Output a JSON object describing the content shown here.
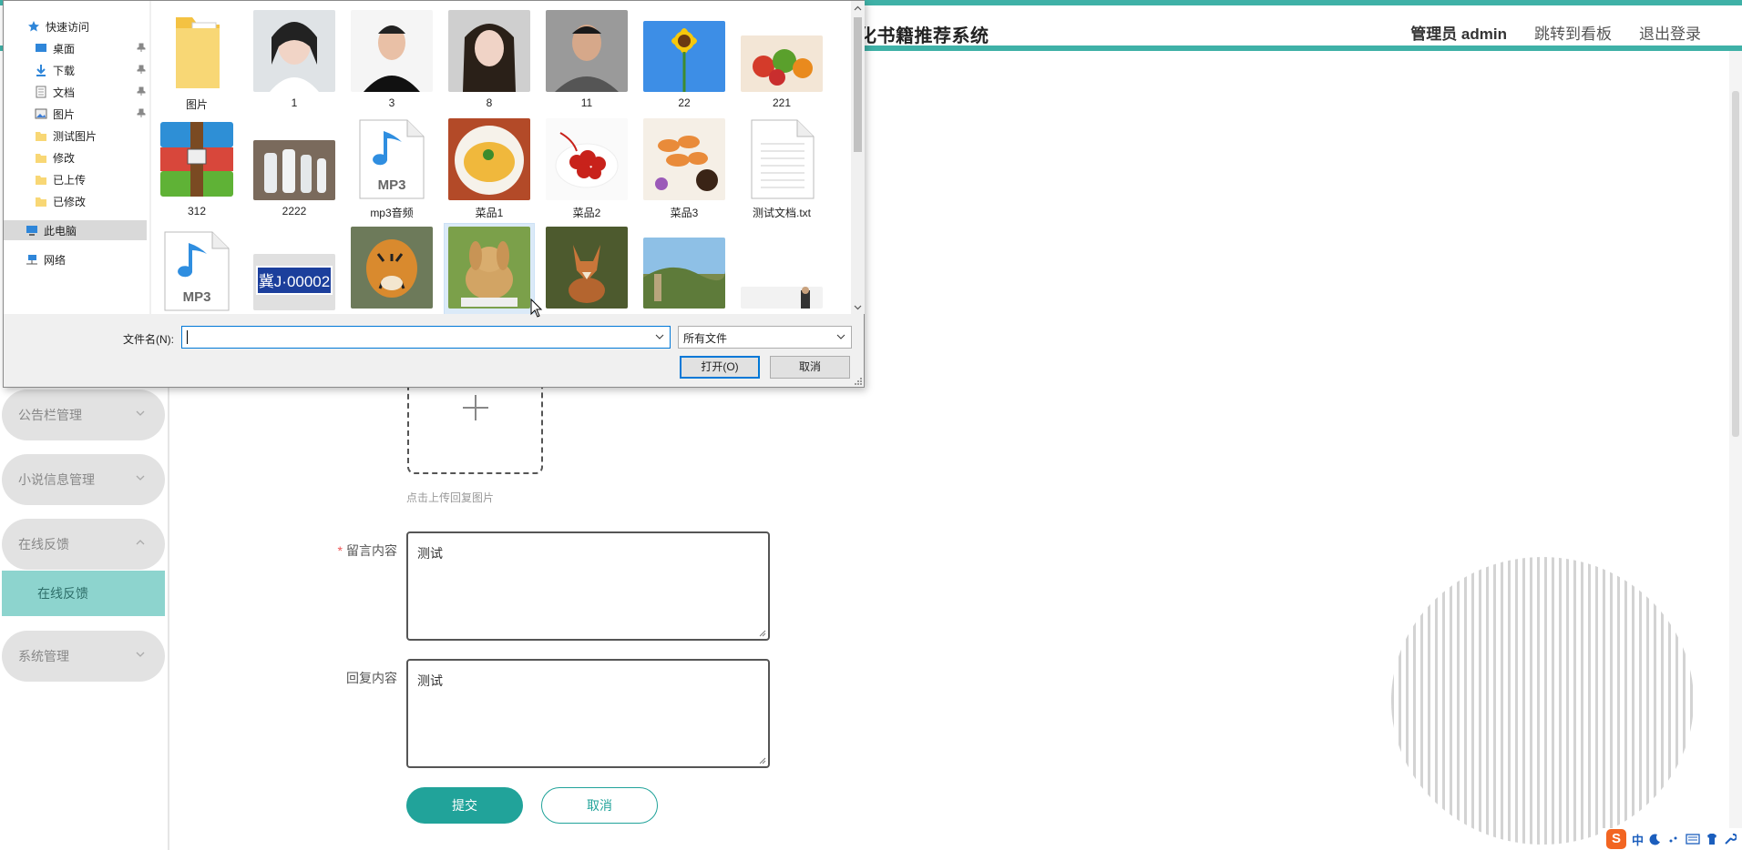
{
  "header": {
    "title": "化书籍推荐系统",
    "admin": "管理员 admin",
    "link_dashboard": "跳转到看板",
    "link_logout": "退出登录"
  },
  "sidebar": {
    "menus": [
      {
        "label": "公告栏管理"
      },
      {
        "label": "小说信息管理"
      },
      {
        "label": "在线反馈"
      },
      {
        "label": "系统管理"
      }
    ],
    "submenu": {
      "label": "在线反馈"
    }
  },
  "form": {
    "upload_hint": "点击上传回复图片",
    "message_label": "留言内容",
    "message_value": "测试",
    "reply_label": "回复内容",
    "reply_value": "测试",
    "submit": "提交",
    "cancel": "取消"
  },
  "dialog": {
    "nav": {
      "quick_access": "快速访问",
      "desktop": "桌面",
      "downloads": "下载",
      "documents": "文档",
      "pictures": "图片",
      "folder1": "测试图片",
      "folder2": "修改",
      "folder3": "已上传",
      "folder4": "已修改",
      "this_pc": "此电脑",
      "network": "网络"
    },
    "files_row1": [
      "图片",
      "1",
      "3",
      "8",
      "11",
      "22",
      "221"
    ],
    "files_row2": [
      "312",
      "2222",
      "mp3音频",
      "菜品1",
      "菜品2",
      "菜品3",
      "测试文档.txt"
    ],
    "filename_label": "文件名(N):",
    "filename_value": "",
    "filetype": "所有文件",
    "open": "打开(O)",
    "cancel": "取消",
    "mp3_badge": "MP3",
    "plate_text": "冀J·00002"
  },
  "tray": {
    "ime": "中"
  },
  "colors": {
    "accent": "#3fb1a7",
    "primary_button": "#21a39a",
    "submenu_bg": "#8dd4ce",
    "menu_pill": "#e2e2e2"
  }
}
